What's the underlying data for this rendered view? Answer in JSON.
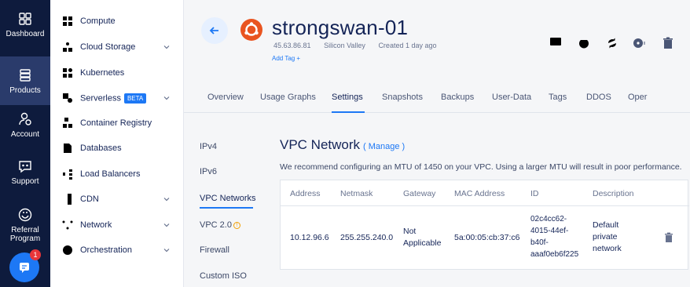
{
  "rail": [
    {
      "label": "Dashboard",
      "icon": "dashboard-icon"
    },
    {
      "label": "Products",
      "icon": "products-icon"
    },
    {
      "label": "Account",
      "icon": "account-icon"
    },
    {
      "label": "Support",
      "icon": "support-icon"
    },
    {
      "label": "Referral\nProgram",
      "icon": "referral-icon"
    }
  ],
  "chat_badge": "1",
  "menu": [
    {
      "label": "Compute",
      "chevron": false
    },
    {
      "label": "Cloud Storage",
      "chevron": true
    },
    {
      "label": "Kubernetes",
      "chevron": false
    },
    {
      "label": "Serverless",
      "badge": "BETA",
      "chevron": true
    },
    {
      "label": "Container Registry",
      "chevron": false
    },
    {
      "label": "Databases",
      "chevron": false
    },
    {
      "label": "Load Balancers",
      "chevron": false
    },
    {
      "label": "CDN",
      "chevron": true
    },
    {
      "label": "Network",
      "chevron": true
    },
    {
      "label": "Orchestration",
      "chevron": true
    }
  ],
  "server": {
    "name": "strongswan-01",
    "ip": "45.63.86.81",
    "location": "Silicon Valley",
    "created": "Created 1 day ago",
    "add_tag": "Add Tag +"
  },
  "tabs": [
    "Overview",
    "Usage Graphs",
    "Settings",
    "Snapshots",
    "Backups",
    "User-Data",
    "Tags",
    "DDOS",
    "Oper"
  ],
  "settings_nav": [
    "IPv4",
    "IPv6",
    "VPC Networks",
    "VPC 2.0",
    "Firewall",
    "Custom ISO"
  ],
  "vpc": {
    "title": "VPC Network",
    "manage": "( Manage )",
    "note": "We recommend configuring an MTU of 1450 on your VPC. Using a larger MTU will result in poor performance.",
    "headers": [
      "Address",
      "Netmask",
      "Gateway",
      "MAC Address",
      "ID",
      "Description"
    ],
    "row": {
      "address": "10.12.96.6",
      "netmask": "255.255.240.0",
      "gateway": "Not\nApplicable",
      "mac": "5a:00:05:cb:37:c6",
      "id": "02c4cc62-\n4015-44ef-\nb40f-\naaaf0eb6f225",
      "description": "Default\nprivate\nnetwork"
    }
  },
  "colors": {
    "rail": "#0e1b3d",
    "accent": "#1d78f5",
    "ubuntu": "#e95420"
  }
}
